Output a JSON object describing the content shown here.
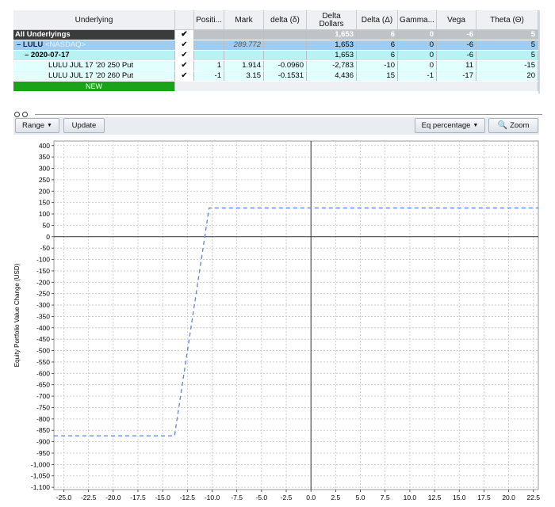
{
  "grid": {
    "headers": {
      "underlying": "Underlying",
      "position": "Positi...",
      "mark": "Mark",
      "delta_sym": "delta (δ)",
      "delta_dollars_l1": "Delta",
      "delta_dollars_l2": "Dollars",
      "delta_cap": "Delta (Δ)",
      "gamma": "Gamma...",
      "vega": "Vega",
      "theta": "Theta (Θ)"
    },
    "rows": {
      "all": {
        "name": "All Underlyings",
        "checked": "✔",
        "delta_dollars": "1,653",
        "delta": "6",
        "gamma": "0",
        "vega": "-6",
        "theta": "5"
      },
      "lulu": {
        "prefix": "– LULU ",
        "exchange": "<NASDAQ>",
        "checked": "✔",
        "mark": "289.772",
        "delta_dollars": "1,653",
        "delta": "6",
        "gamma": "0",
        "vega": "-6",
        "theta": "5"
      },
      "expiry": {
        "name": "– 2020-07-17",
        "checked": "✔",
        "delta_dollars": "1,653",
        "delta": "6",
        "gamma": "0",
        "vega": "-6",
        "theta": "5"
      },
      "leg1": {
        "name": "LULU JUL 17 '20 250 Put",
        "checked": "✔",
        "position": "1",
        "mark": "1.914",
        "delta_sym": "-0.0960",
        "delta_dollars": "-2,783",
        "delta": "-10",
        "gamma": "0",
        "vega": "11",
        "theta": "-15"
      },
      "leg2": {
        "name": "LULU JUL 17 '20 260 Put",
        "checked": "✔",
        "position": "-1",
        "mark": "3.15",
        "delta_sym": "-0.1531",
        "delta_dollars": "4,436",
        "delta": "15",
        "gamma": "-1",
        "vega": "-17",
        "theta": "20"
      },
      "new": {
        "name": "NEW"
      }
    }
  },
  "toolbar": {
    "range_label": "Range",
    "update_label": "Update",
    "eq_label": "Eq percentage",
    "zoom_label": "Zoom"
  },
  "chart_data": {
    "type": "line",
    "title": "",
    "xlabel": "",
    "ylabel": "Equity Portfolio Value Change (USD)",
    "xlim": [
      -26,
      23
    ],
    "ylim": [
      -1110,
      420
    ],
    "x_ticks": [
      -25.0,
      -22.5,
      -20.0,
      -17.5,
      -15.0,
      -12.5,
      -10.0,
      -7.5,
      -5.0,
      -2.5,
      0.0,
      2.5,
      5.0,
      7.5,
      10.0,
      12.5,
      15.0,
      17.5,
      20.0,
      22.5
    ],
    "y_ticks": [
      400,
      350,
      300,
      250,
      200,
      150,
      100,
      50,
      0,
      -50,
      -100,
      -150,
      -200,
      -250,
      -300,
      -350,
      -400,
      -450,
      -500,
      -550,
      -600,
      -650,
      -700,
      -750,
      -800,
      -850,
      -900,
      -950,
      -1000,
      -1050,
      -1100
    ],
    "grid": true,
    "series": [
      {
        "x": [
          -26,
          -13.8,
          -10.3,
          23
        ],
        "y": [
          -874,
          -874,
          126,
          126
        ],
        "color": "#5b85d9",
        "style": "dashed"
      }
    ]
  }
}
